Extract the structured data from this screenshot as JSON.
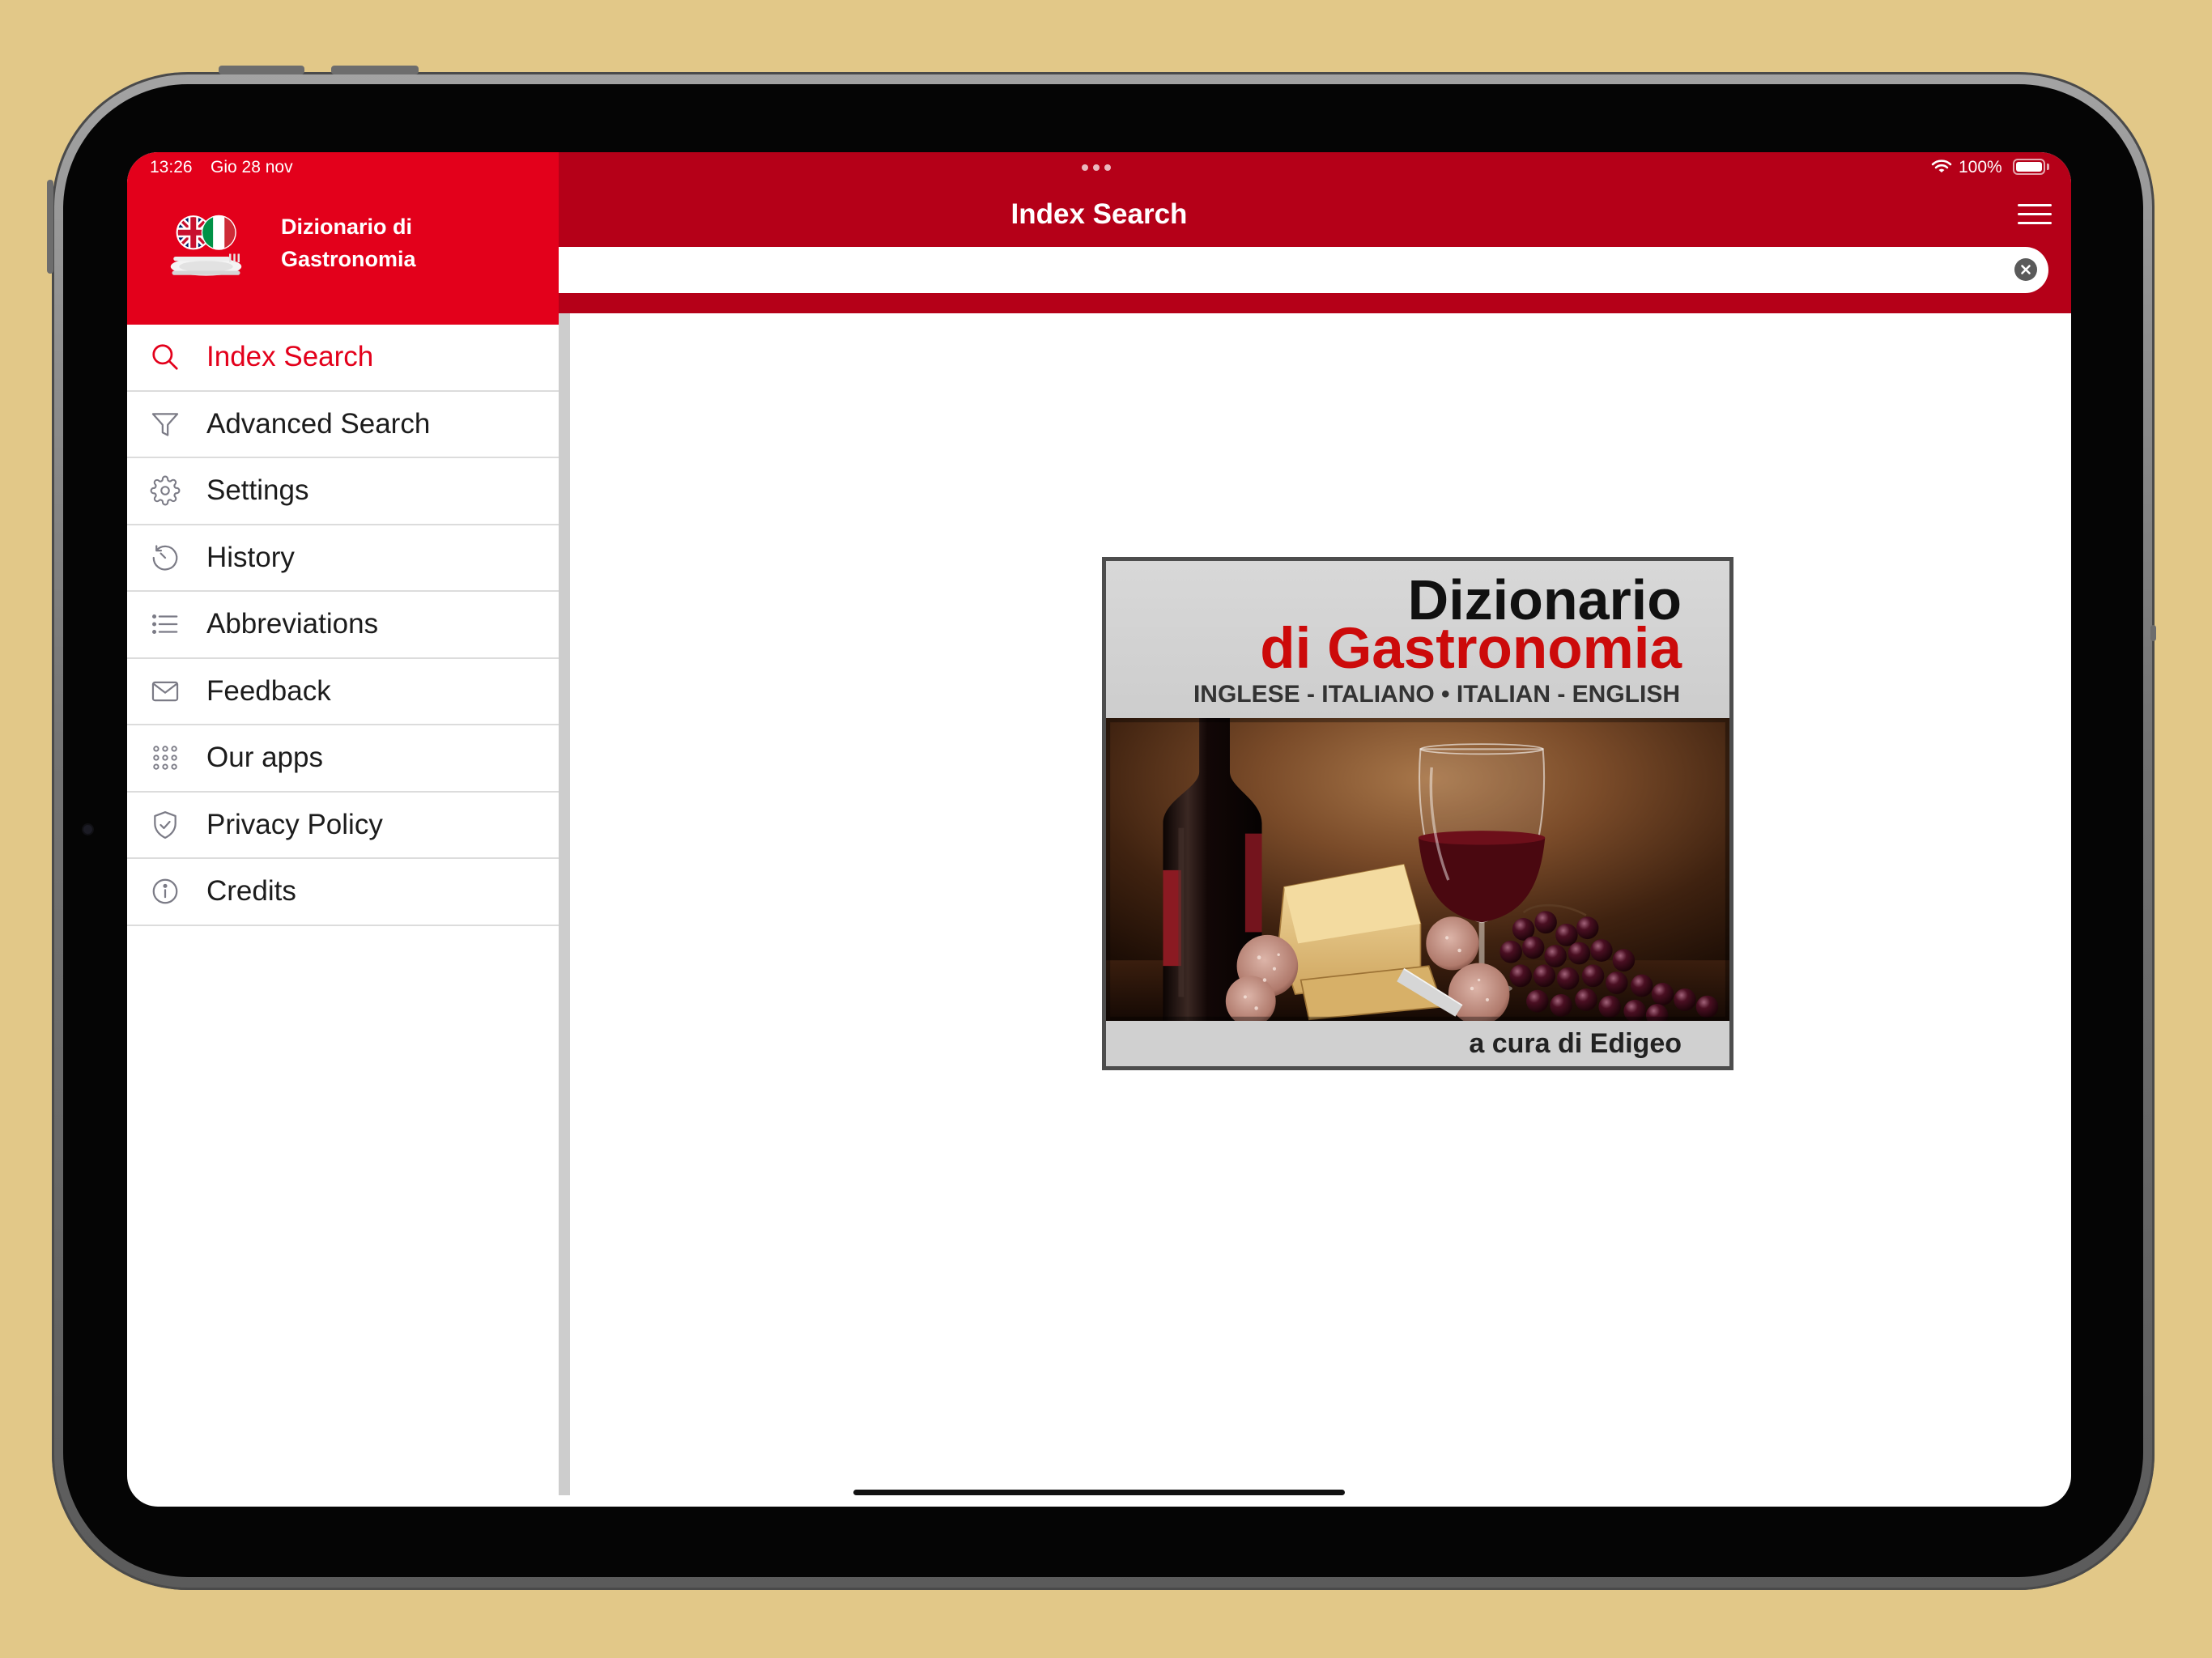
{
  "status_bar": {
    "time": "13:26",
    "date": "Gio 28 nov",
    "battery_level": "100%",
    "icons": [
      "wifi-icon",
      "battery-icon"
    ]
  },
  "app": {
    "name_line1": "Dizionario di",
    "name_line2": "Gastronomia",
    "logo_icon": "uk-italy-flags-plate-logo"
  },
  "nav": {
    "title": "Index Search",
    "menu_icon": "hamburger-icon"
  },
  "search": {
    "value": "",
    "clear_icon": "clear-circle-icon"
  },
  "sidebar": {
    "items": [
      {
        "label": "Index Search",
        "icon": "search-icon",
        "active": true
      },
      {
        "label": "Advanced Search",
        "icon": "filter-icon",
        "active": false
      },
      {
        "label": "Settings",
        "icon": "gear-icon",
        "active": false
      },
      {
        "label": "History",
        "icon": "history-icon",
        "active": false
      },
      {
        "label": "Abbreviations",
        "icon": "list-icon",
        "active": false
      },
      {
        "label": "Feedback",
        "icon": "envelope-icon",
        "active": false
      },
      {
        "label": "Our apps",
        "icon": "grid-icon",
        "active": false
      },
      {
        "label": "Privacy Policy",
        "icon": "shield-check-icon",
        "active": false
      },
      {
        "label": "Credits",
        "icon": "info-icon",
        "active": false
      }
    ]
  },
  "cover": {
    "title_line1": "Dizionario",
    "title_line2": "di Gastronomia",
    "languages": "INGLESE - ITALIANO • ITALIAN - ENGLISH",
    "credit": "a cura di Edigeo"
  },
  "colors": {
    "sidebar_header_red": "#E3001B",
    "nav_red": "#B50018",
    "active_item_red": "#E3001B",
    "cover_title_red": "#CC0A0A",
    "background": "#E2C888"
  }
}
